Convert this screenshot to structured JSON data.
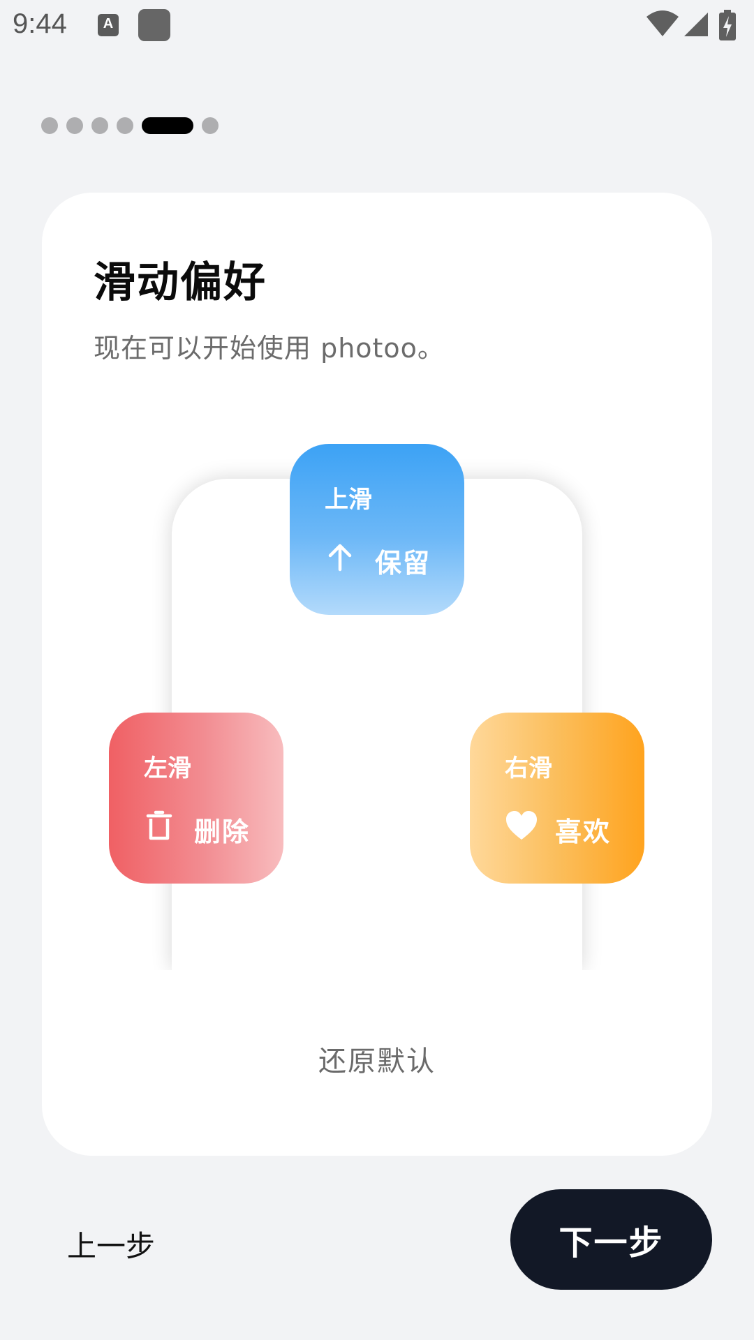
{
  "status_bar": {
    "time": "9:44",
    "a_icon_text": "A"
  },
  "page_indicator": {
    "total": 6,
    "active_index": 4
  },
  "card": {
    "title": "滑动偏好",
    "subtitle": "现在可以开始使用 photoo。",
    "swipe_up": {
      "direction": "上滑",
      "action": "保留",
      "icon": "arrow-up-icon",
      "colors": [
        "#3ca2f5",
        "#b3dafb"
      ]
    },
    "swipe_left": {
      "direction": "左滑",
      "action": "删除",
      "icon": "trash-icon",
      "colors": [
        "#f06064",
        "#f8bcbe"
      ]
    },
    "swipe_right": {
      "direction": "右滑",
      "action": "喜欢",
      "icon": "heart-icon",
      "colors": [
        "#ffd89a",
        "#ffa31e"
      ]
    },
    "reset_label": "还原默认"
  },
  "nav": {
    "prev_label": "上一步",
    "next_label": "下一步"
  },
  "colors": {
    "background": "#f2f3f5",
    "primary_button": "#121826"
  }
}
